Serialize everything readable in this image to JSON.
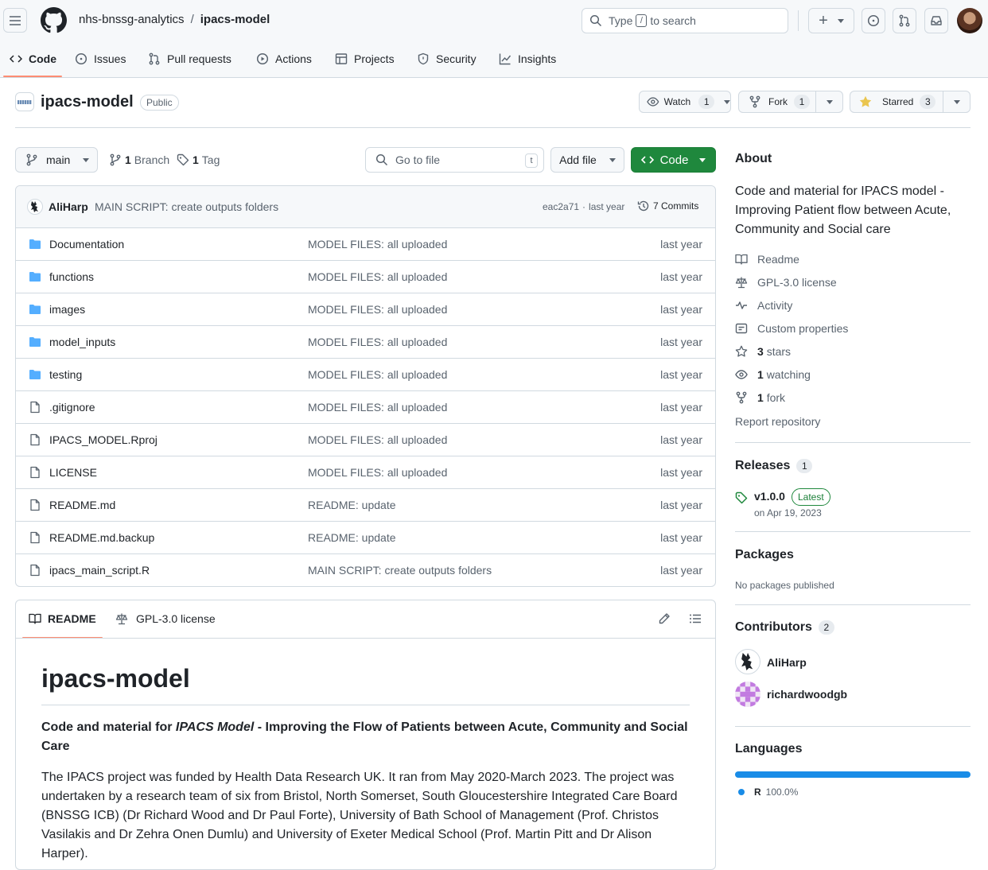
{
  "header": {
    "owner": "nhs-bnssg-analytics",
    "separator": "/",
    "repo": "ipacs-model",
    "search_prefix": "Type",
    "search_key": "/",
    "search_suffix": "to search",
    "plus": "+"
  },
  "tabs": [
    {
      "label": "Code"
    },
    {
      "label": "Issues"
    },
    {
      "label": "Pull requests"
    },
    {
      "label": "Actions"
    },
    {
      "label": "Projects"
    },
    {
      "label": "Security"
    },
    {
      "label": "Insights"
    }
  ],
  "repo_header": {
    "name": "ipacs-model",
    "visibility": "Public",
    "watch_label": "Watch",
    "watch_count": "1",
    "fork_label": "Fork",
    "fork_count": "1",
    "star_label": "Starred",
    "star_count": "3"
  },
  "toolbar": {
    "branch": "main",
    "branch_count": "1",
    "branch_word": "Branch",
    "tag_count": "1",
    "tag_word": "Tag",
    "goto_placeholder": "Go to file",
    "goto_key": "t",
    "add_file": "Add file",
    "code": "Code"
  },
  "commit": {
    "author": "AliHarp",
    "message": "MAIN SCRIPT: create outputs folders",
    "sha": "eac2a71",
    "dot": "·",
    "when": "last year",
    "commits": "7 Commits"
  },
  "files": [
    {
      "name": "Documentation",
      "type": "dir",
      "message": "MODEL FILES: all uploaded",
      "when": "last year"
    },
    {
      "name": "functions",
      "type": "dir",
      "message": "MODEL FILES: all uploaded",
      "when": "last year"
    },
    {
      "name": "images",
      "type": "dir",
      "message": "MODEL FILES: all uploaded",
      "when": "last year"
    },
    {
      "name": "model_inputs",
      "type": "dir",
      "message": "MODEL FILES: all uploaded",
      "when": "last year"
    },
    {
      "name": "testing",
      "type": "dir",
      "message": "MODEL FILES: all uploaded",
      "when": "last year"
    },
    {
      "name": ".gitignore",
      "type": "file",
      "message": "MODEL FILES: all uploaded",
      "when": "last year"
    },
    {
      "name": "IPACS_MODEL.Rproj",
      "type": "file",
      "message": "MODEL FILES: all uploaded",
      "when": "last year"
    },
    {
      "name": "LICENSE",
      "type": "file",
      "message": "MODEL FILES: all uploaded",
      "when": "last year"
    },
    {
      "name": "README.md",
      "type": "file",
      "message": "README: update",
      "when": "last year"
    },
    {
      "name": "README.md.backup",
      "type": "file",
      "message": "README: update",
      "when": "last year"
    },
    {
      "name": "ipacs_main_script.R",
      "type": "file",
      "message": "MAIN SCRIPT: create outputs folders",
      "when": "last year"
    }
  ],
  "readme": {
    "tab_readme": "README",
    "tab_license": "GPL-3.0 license",
    "title": "ipacs-model",
    "subtitle_a": "Code and material for ",
    "subtitle_em": "IPACS Model",
    "subtitle_b": " - Improving the Flow of Patients between Acute, Community and Social Care",
    "paragraph": "The IPACS project was funded by Health Data Research UK. It ran from May 2020-March 2023. The project was undertaken by a research team of six from Bristol, North Somerset, South Gloucestershire Integrated Care Board (BNSSG ICB) (Dr Richard Wood and Dr Paul Forte), University of Bath School of Management (Prof. Christos Vasilakis and Dr Zehra Onen Dumlu) and University of Exeter Medical School (Prof. Martin Pitt and Dr Alison Harper)."
  },
  "about": {
    "heading": "About",
    "description": "Code and material for IPACS model - Improving Patient flow between Acute, Community and Social care",
    "readme": "Readme",
    "license": "GPL-3.0 license",
    "activity": "Activity",
    "custom": "Custom properties",
    "stars_num": "3",
    "stars_word": "stars",
    "watching_num": "1",
    "watching_word": "watching",
    "fork_num": "1",
    "fork_word": "fork",
    "report": "Report repository"
  },
  "releases": {
    "heading": "Releases",
    "count": "1",
    "tag": "v1.0.0",
    "badge": "Latest",
    "date": "on Apr 19, 2023"
  },
  "packages": {
    "heading": "Packages",
    "text": "No packages published"
  },
  "contributors": {
    "heading": "Contributors",
    "count": "2",
    "people": [
      {
        "name": "AliHarp"
      },
      {
        "name": "richardwoodgb"
      }
    ]
  },
  "languages": {
    "heading": "Languages",
    "items": [
      {
        "name": "R",
        "percent": "100.0%",
        "color": "#198ce7"
      }
    ]
  },
  "colors": {
    "accent_blue": "#0969da",
    "green": "#1f883d",
    "tab_underline": "#fd8c73",
    "folder": "#54aeff",
    "star": "#eac54f"
  }
}
